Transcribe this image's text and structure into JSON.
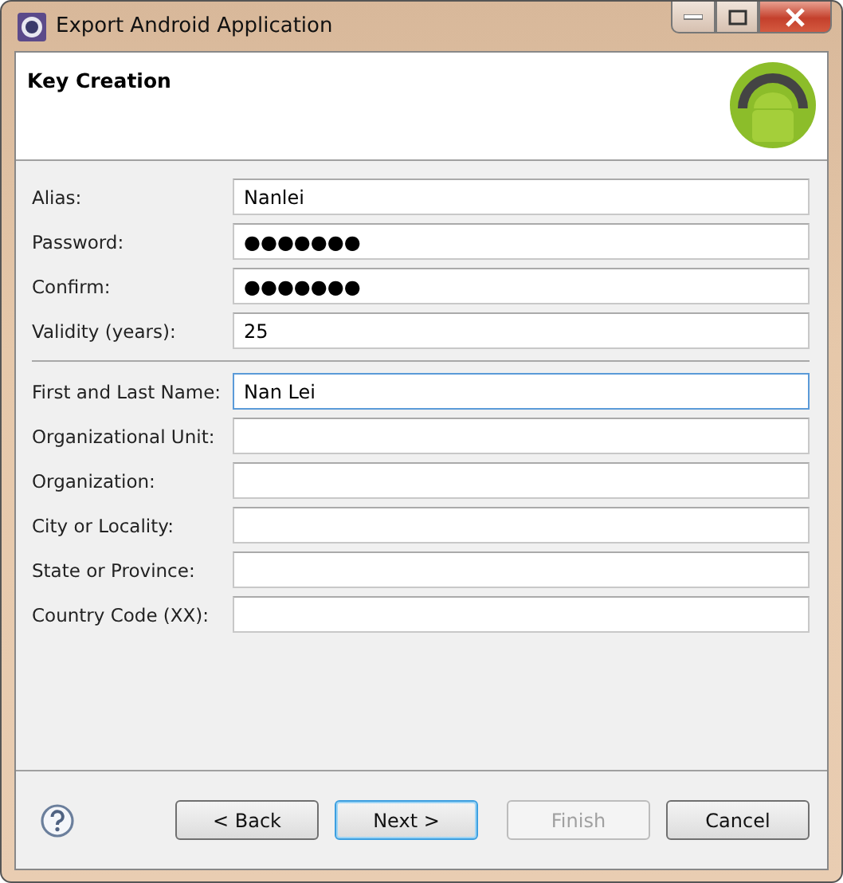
{
  "window": {
    "title": "Export Android Application"
  },
  "header": {
    "title": "Key Creation"
  },
  "sections": [
    {
      "fields": [
        {
          "label": "Alias:",
          "value": "Nanlei",
          "focused": false
        },
        {
          "label": "Password:",
          "value": "●●●●●●●",
          "focused": false
        },
        {
          "label": "Confirm:",
          "value": "●●●●●●●",
          "focused": false
        },
        {
          "label": "Validity (years):",
          "value": "25",
          "focused": false
        }
      ]
    },
    {
      "fields": [
        {
          "label": "First and Last Name:",
          "value": "Nan Lei",
          "focused": true
        },
        {
          "label": "Organizational Unit:",
          "focused": false
        },
        {
          "label": "Organization:",
          "focused": false
        },
        {
          "label": "City or Locality:",
          "focused": false
        },
        {
          "label": "State or Province:",
          "focused": false
        },
        {
          "label": "Country Code (XX):",
          "focused": false
        }
      ]
    }
  ],
  "buttons": [
    {
      "label": "< Back",
      "default": false,
      "disabled": false
    },
    {
      "label": "Next >",
      "default": true,
      "disabled": false
    },
    {
      "label": "Finish",
      "default": false,
      "disabled": true
    },
    {
      "label": "Cancel",
      "default": false,
      "disabled": false
    }
  ]
}
